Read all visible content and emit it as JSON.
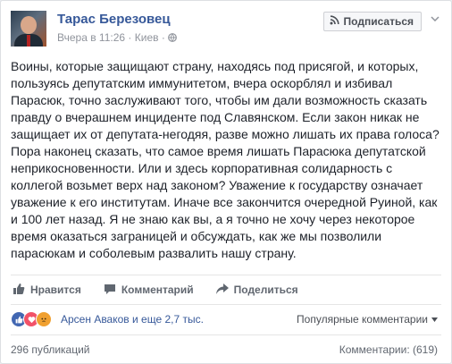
{
  "post": {
    "author": "Тарас Березовец",
    "timestamp": "Вчера в 11:26",
    "location": "Киев",
    "subscribe_label": "Подписаться",
    "text": "Воины, которые защищают страну, находясь под присягой, и которых, пользуясь депутатским иммунитетом, вчера оскорблял и избивал Парасюк, точно заслуживают того, чтобы им дали возможность сказать правду о вчерашнем инциденте под Славянском. Если закон никак не защищает их от депутата-негодяя, разве можно лишать их права голоса? Пора наконец сказать, что самое время лишать Парасюка депутатской неприкосновенности. Или и здесь корпоративная солидарность с коллегой возьмет верх над законом? Уважение к государству означает уважение к его институтам. Иначе все закончится очередной Руиной, как и 100 лет назад. Я не знаю как вы, а я точно не хочу через некоторое время оказаться заграницей и обсуждать, как же мы позволили парасюкам и соболевым развалить нашу страну."
  },
  "actions": {
    "like": "Нравится",
    "comment": "Комментарий",
    "share": "Поделиться"
  },
  "reactions": {
    "summary": "Арсен Аваков и еще 2,7 тыс.",
    "sort_label": "Популярные комментарии"
  },
  "footer": {
    "shares": "296 публикаций",
    "comments": "Комментарии: (619)"
  }
}
